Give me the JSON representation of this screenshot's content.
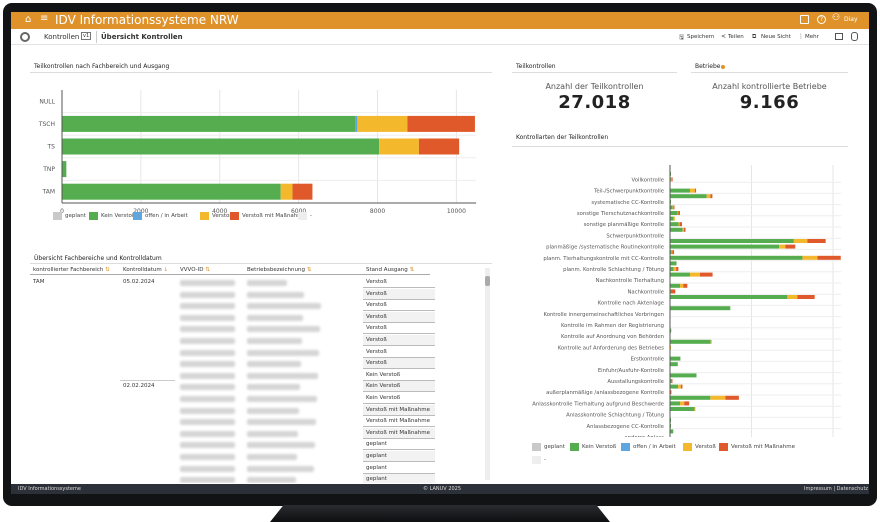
{
  "app": {
    "title": "IDV Informationssysteme NRW",
    "user": "Diay",
    "icons": [
      "home-icon",
      "menu-icon",
      "screen-icon",
      "help-icon",
      "user-icon"
    ]
  },
  "toolbar": {
    "breadcrumb": "Kontrollen",
    "version_badge": "v1",
    "view": "Übersicht Kontrollen",
    "save": "Speichern",
    "share": "Teilen",
    "new_view": "Neue Sicht",
    "more": "Mehr"
  },
  "colors": {
    "header": "#df922a",
    "geplant": "#c9c9c9",
    "kein": "#55ad4f",
    "offen": "#5ea6e0",
    "verstoss": "#f3b82c",
    "massnahme": "#e0592a",
    "dash": "#eeeeee"
  },
  "legend": [
    "geplant",
    "Kein Verstoß",
    "offen / in Arbeit",
    "Verstoß",
    "Verstoß mit Maßnahme",
    "-"
  ],
  "kpi": {
    "teil": {
      "section": "Teilkontrollen",
      "label": "Anzahl der Teilkontrollen",
      "value": "27.018"
    },
    "betriebe": {
      "section": "Betriebe",
      "label": "Anzahl kontrollierte Betriebe",
      "value": "9.166"
    }
  },
  "chart_data": [
    {
      "type": "bar",
      "orientation": "horizontal",
      "stacked": true,
      "title": "Teilkontrollen nach Fachbereich und Ausgang",
      "categories": [
        "NULL",
        "TSCH",
        "TS",
        "TNP",
        "TAM"
      ],
      "xlim": [
        0,
        10500
      ],
      "xticks": [
        0,
        2000,
        4000,
        6000,
        8000,
        10000
      ],
      "grid": true,
      "legend": "bottom",
      "series": [
        {
          "name": "geplant",
          "values": [
            0,
            0,
            0,
            0,
            0
          ]
        },
        {
          "name": "Kein Verstoß",
          "values": [
            0,
            7430,
            8040,
            110,
            5545
          ]
        },
        {
          "name": "offen / in Arbeit",
          "values": [
            0,
            60,
            0,
            0,
            0
          ]
        },
        {
          "name": "Verstoß",
          "values": [
            0,
            1270,
            1010,
            0,
            300
          ]
        },
        {
          "name": "Verstoß mit Maßnahme",
          "values": [
            0,
            1710,
            1020,
            0,
            505
          ]
        },
        {
          "name": "-",
          "values": [
            0,
            0,
            0,
            0,
            0
          ]
        }
      ]
    },
    {
      "type": "bar",
      "orientation": "horizontal",
      "stacked": true,
      "title": "Kontrollarten der Teilkontrollen",
      "labels": [
        "Vollkontrolle",
        "Teil-/Schwerpunktkontrolle",
        "systematische CC-Kontrolle",
        "sonstige Tierschutznachkontrolle",
        "sonstige planmäßige Kontrolle",
        "Schwerpunktkontrolle",
        "planmäßige /systematische Routinekontrolle",
        "planm. Tierhaltungskontrolle mit CC-Kontrolle",
        "planm. Kontrolle Schlachtung / Tötung",
        "Nachkontrolle Tierhaltung",
        "Nachkontrolle",
        "Kontrolle nach Aktenlage",
        "Kontrolle innergemeinschaftliches Verbringen",
        "Kontrolle im Rahmen der Registrierung",
        "Kontrolle auf Anordnung von Behörden",
        "Kontrolle auf Anforderung des Betriebes",
        "Erstkontrolle",
        "Einfuhr/Ausfuhr-Kontrolle",
        "Ausstallungskontrolle",
        "außerplanmäßige /anlassbezogene  Kontrolle",
        "Anlasskontrolle Tierhaltung aufgrund Beschwerde",
        "Anlasskontrolle Schlachtung / Tötung",
        "Anlassbezogene CC-Kontrolle",
        "anderer Anlass"
      ],
      "xlim": [
        0,
        4200
      ],
      "xticks": [
        0,
        2000,
        4000
      ],
      "grid": true,
      "legend": "bottom",
      "rows": [
        [
          10,
          0,
          0
        ],
        [
          20,
          20,
          15
        ],
        [
          0,
          0,
          0
        ],
        [
          490,
          120,
          30
        ],
        [
          900,
          90,
          50
        ],
        [
          10,
          0,
          0
        ],
        [
          65,
          20,
          15
        ],
        [
          190,
          15,
          40
        ],
        [
          90,
          30,
          0
        ],
        [
          210,
          25,
          60
        ],
        [
          310,
          30,
          40
        ],
        [
          0,
          0,
          0
        ],
        [
          3040,
          330,
          450
        ],
        [
          2680,
          150,
          245
        ],
        [
          40,
          20,
          40
        ],
        [
          3250,
          370,
          570
        ],
        [
          160,
          0,
          0
        ],
        [
          90,
          60,
          55
        ],
        [
          490,
          245,
          310
        ],
        [
          0,
          0,
          0
        ],
        [
          245,
          80,
          100
        ],
        [
          20,
          0,
          110
        ],
        [
          2880,
          245,
          425
        ],
        [
          0,
          0,
          0
        ],
        [
          1480,
          0,
          0
        ],
        [
          0,
          0,
          0
        ],
        [
          0,
          0,
          0
        ],
        [
          0,
          0,
          0
        ],
        [
          30,
          0,
          0
        ],
        [
          0,
          0,
          0
        ],
        [
          1000,
          15,
          0
        ],
        [
          0,
          15,
          0
        ],
        [
          0,
          0,
          0
        ],
        [
          255,
          0,
          0
        ],
        [
          190,
          0,
          0
        ],
        [
          0,
          0,
          0
        ],
        [
          650,
          0,
          0
        ],
        [
          30,
          0,
          30
        ],
        [
          200,
          65,
          40
        ],
        [
          0,
          0,
          35
        ],
        [
          990,
          370,
          330
        ],
        [
          245,
          105,
          120
        ],
        [
          600,
          25,
          0
        ],
        [
          0,
          0,
          0
        ],
        [
          10,
          0,
          0
        ],
        [
          10,
          0,
          0
        ],
        [
          80,
          0,
          0
        ],
        [
          0,
          0,
          0
        ]
      ],
      "row_series": [
        "Kein Verstoß",
        "Verstoß",
        "Verstoß mit Maßnahme"
      ]
    }
  ],
  "table": {
    "title": "Übersicht Fachbereiche und Kontrolldatum",
    "columns": [
      "kontrollierter Fachbereich",
      "Kontrolldatum",
      "VVVO-ID",
      "Betriebsbezeichnung",
      "Stand Ausgang"
    ],
    "rows": [
      {
        "fb": "TAM",
        "date": "05.02.2024",
        "stand": "Verstoß"
      },
      {
        "fb": "",
        "date": "",
        "stand": "Verstoß"
      },
      {
        "fb": "",
        "date": "",
        "stand": "Verstoß"
      },
      {
        "fb": "",
        "date": "",
        "stand": "Verstoß"
      },
      {
        "fb": "",
        "date": "",
        "stand": "Verstoß"
      },
      {
        "fb": "",
        "date": "",
        "stand": "Verstoß"
      },
      {
        "fb": "",
        "date": "",
        "stand": "Verstoß"
      },
      {
        "fb": "",
        "date": "",
        "stand": "Verstoß"
      },
      {
        "fb": "",
        "date": "",
        "stand": "Kein Verstoß"
      },
      {
        "fb": "",
        "date": "02.02.2024",
        "stand": "Kein Verstoß"
      },
      {
        "fb": "",
        "date": "",
        "stand": "Kein Verstoß"
      },
      {
        "fb": "",
        "date": "",
        "stand": "Verstoß mit Maßnahme"
      },
      {
        "fb": "",
        "date": "",
        "stand": "Verstoß mit Maßnahme"
      },
      {
        "fb": "",
        "date": "",
        "stand": "Verstoß mit Maßnahme"
      },
      {
        "fb": "",
        "date": "",
        "stand": "geplant"
      },
      {
        "fb": "",
        "date": "",
        "stand": "geplant"
      },
      {
        "fb": "",
        "date": "",
        "stand": "geplant"
      },
      {
        "fb": "",
        "date": "",
        "stand": "geplant"
      }
    ]
  },
  "footer": {
    "left": "IDV Informationssysteme",
    "center": "© LANUV 2025",
    "right": "Impressum | Datenschutz"
  }
}
